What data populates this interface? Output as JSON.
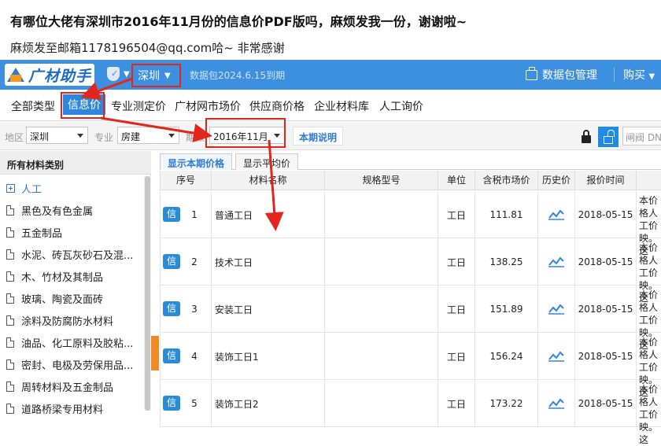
{
  "post": {
    "title": "有哪位大佬有深圳市2016年11月份的信息价PDF版吗，麻烦发我一份，谢谢啦~",
    "subtitle": "麻烦发至邮箱1178196504@qq.com哈~    非常感谢"
  },
  "app": {
    "logo_text": "广材助手",
    "city": "深圳",
    "package_status": "数据包2024.6.15到期",
    "package_manage": "数据包管理",
    "buy": "购买"
  },
  "tabs": [
    "全部类型",
    "信息价",
    "专业测定价",
    "广材网市场价",
    "供应商价格",
    "企业材料库",
    "人工询价"
  ],
  "filters": {
    "region_label": "地区",
    "region_value": "深圳",
    "specialty_label": "专业",
    "specialty_value": "房建",
    "period_label": "期数",
    "period_value": "2016年11月",
    "period_note": "本期说明",
    "search_placeholder": "闸阀 DN"
  },
  "sidebar": {
    "header": "所有材料类别",
    "items": [
      {
        "label": "人工",
        "type": "root"
      },
      {
        "label": "黑色及有色金属",
        "type": "doc"
      },
      {
        "label": "五金制品",
        "type": "doc"
      },
      {
        "label": "水泥、砖瓦灰砂石及混...",
        "type": "doc"
      },
      {
        "label": "木、竹材及其制品",
        "type": "doc"
      },
      {
        "label": "玻璃、陶瓷及面砖",
        "type": "doc"
      },
      {
        "label": "涂料及防腐防水材料",
        "type": "doc"
      },
      {
        "label": "油品、化工原料及胶粘...",
        "type": "doc"
      },
      {
        "label": "密封、电极及劳保用品...",
        "type": "doc"
      },
      {
        "label": "周转材料及五金制品",
        "type": "doc"
      },
      {
        "label": "道路桥梁专用材料",
        "type": "doc"
      }
    ]
  },
  "subtabs": [
    "显示本期价格",
    "显示平均价"
  ],
  "table": {
    "headers": [
      "序号",
      "材料名称",
      "规格型号",
      "单位",
      "含税市场价",
      "历史价",
      "报价时间",
      ""
    ],
    "badge": "信",
    "rows": [
      {
        "no": "1",
        "name": "普通工日",
        "spec": "",
        "unit": "工日",
        "price": "111.81",
        "date": "2018-05-15",
        "remark": "本价格人工价映。这"
      },
      {
        "no": "2",
        "name": "技术工日",
        "spec": "",
        "unit": "工日",
        "price": "138.25",
        "date": "2018-05-15",
        "remark": "本价格人工价映。这"
      },
      {
        "no": "3",
        "name": "安装工日",
        "spec": "",
        "unit": "工日",
        "price": "151.89",
        "date": "2018-05-15",
        "remark": "本价格人工价映。这"
      },
      {
        "no": "4",
        "name": "装饰工日1",
        "spec": "",
        "unit": "工日",
        "price": "156.24",
        "date": "2018-05-15",
        "remark": "本价格人工价映。这"
      },
      {
        "no": "5",
        "name": "装饰工日2",
        "spec": "",
        "unit": "工日",
        "price": "173.22",
        "date": "2018-05-15",
        "remark": "本价格人工价映。这"
      }
    ]
  },
  "colors": {
    "topbar": "#3d8fe0",
    "accent": "#2e86de",
    "annotation_red": "#e3261c",
    "collapse_orange": "#f08a24"
  }
}
